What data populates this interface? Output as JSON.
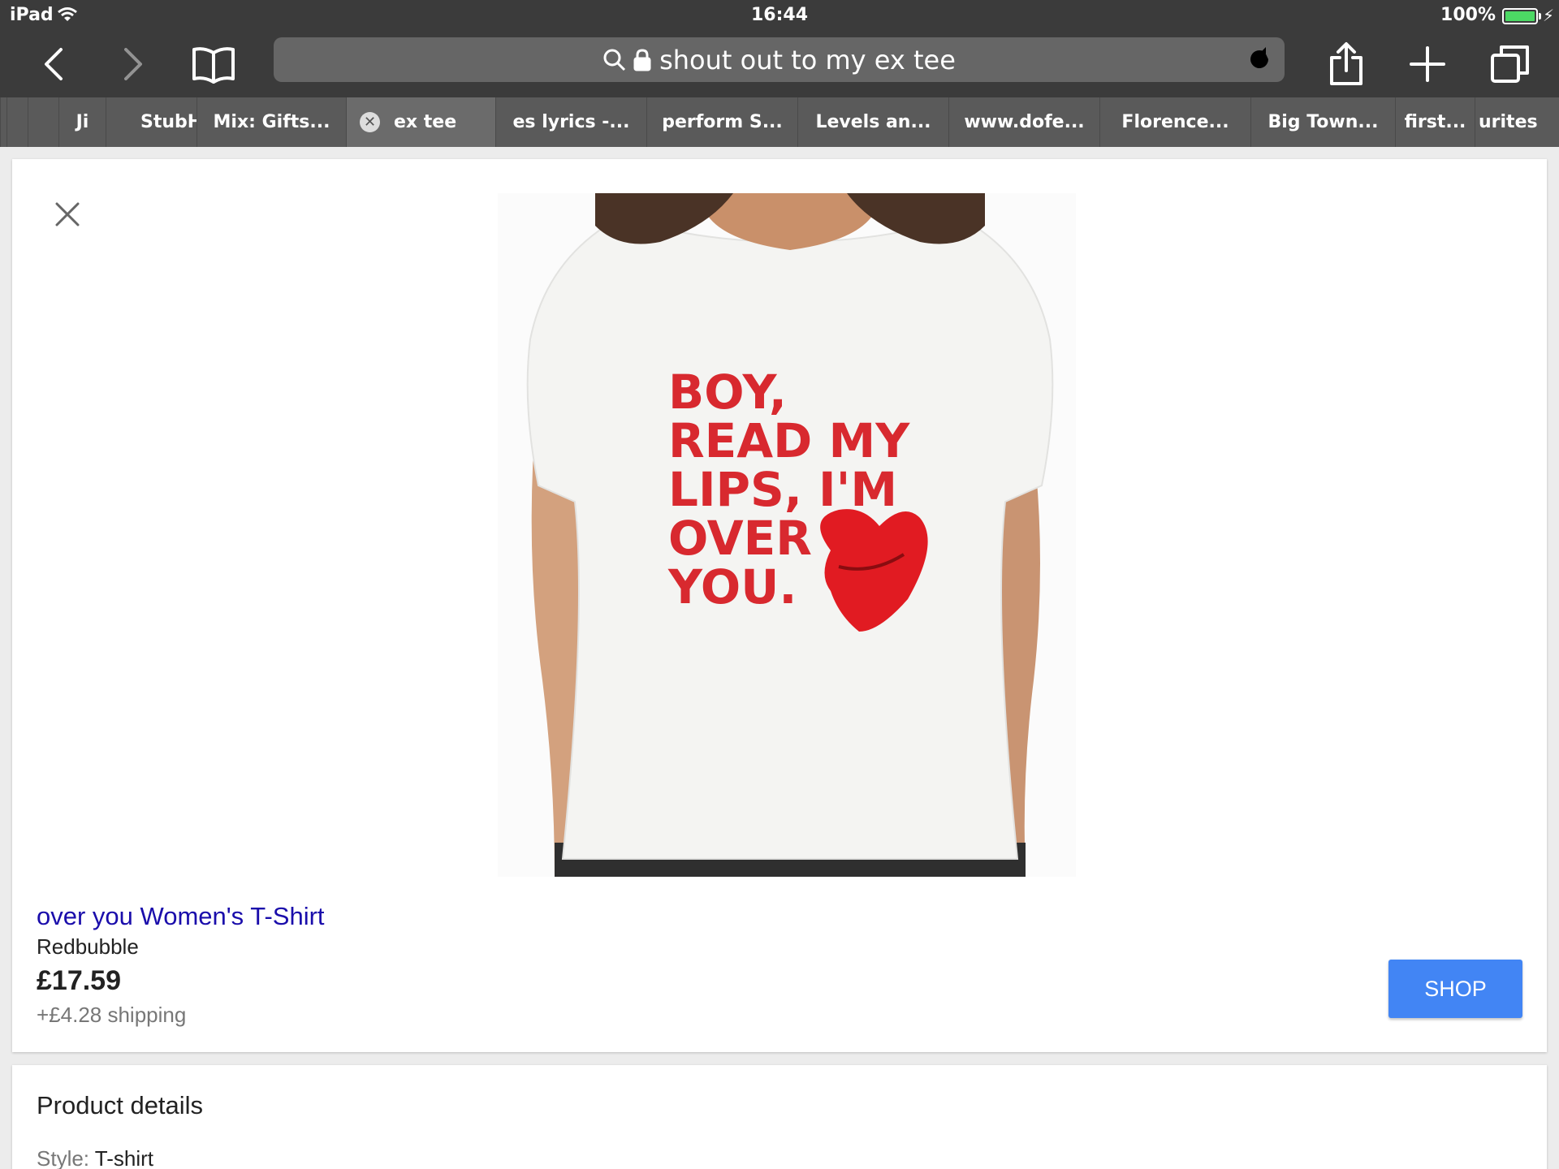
{
  "status_bar": {
    "device": "iPad",
    "time": "16:44",
    "battery_percent": "100%",
    "battery_level": 1.0
  },
  "toolbar": {
    "search_text": "shout out to my ex tee",
    "icons": [
      "back-icon",
      "forward-icon",
      "bookmarks-icon",
      "search-icon",
      "lock-icon",
      "reload-icon",
      "share-icon",
      "new-tab-icon",
      "tabs-icon"
    ]
  },
  "tabs": [
    {
      "label": "Ji"
    },
    {
      "label": "StubH"
    },
    {
      "label": "Mix: Gifts..."
    },
    {
      "label": "ex tee",
      "active": true
    },
    {
      "label": "es lyrics -..."
    },
    {
      "label": "perform S..."
    },
    {
      "label": "Levels an..."
    },
    {
      "label": "www.dofe..."
    },
    {
      "label": "Florence..."
    },
    {
      "label": "Big Town..."
    },
    {
      "label": "first..."
    },
    {
      "label": "urites"
    }
  ],
  "product": {
    "image_text": "BOY, READ MY LIPS, I'M OVER YOU.",
    "title": "over you Women's T-Shirt",
    "seller": "Redbubble",
    "price": "£17.59",
    "shipping": "+£4.28 shipping",
    "shop_label": "SHOP"
  },
  "details": {
    "heading": "Product details",
    "style_label": "Style:",
    "style_value": "T-shirt"
  },
  "colors": {
    "chrome": "#3b3b3b",
    "link": "#1a0dab",
    "shop_button": "#4285f4",
    "battery": "#4cd964"
  }
}
